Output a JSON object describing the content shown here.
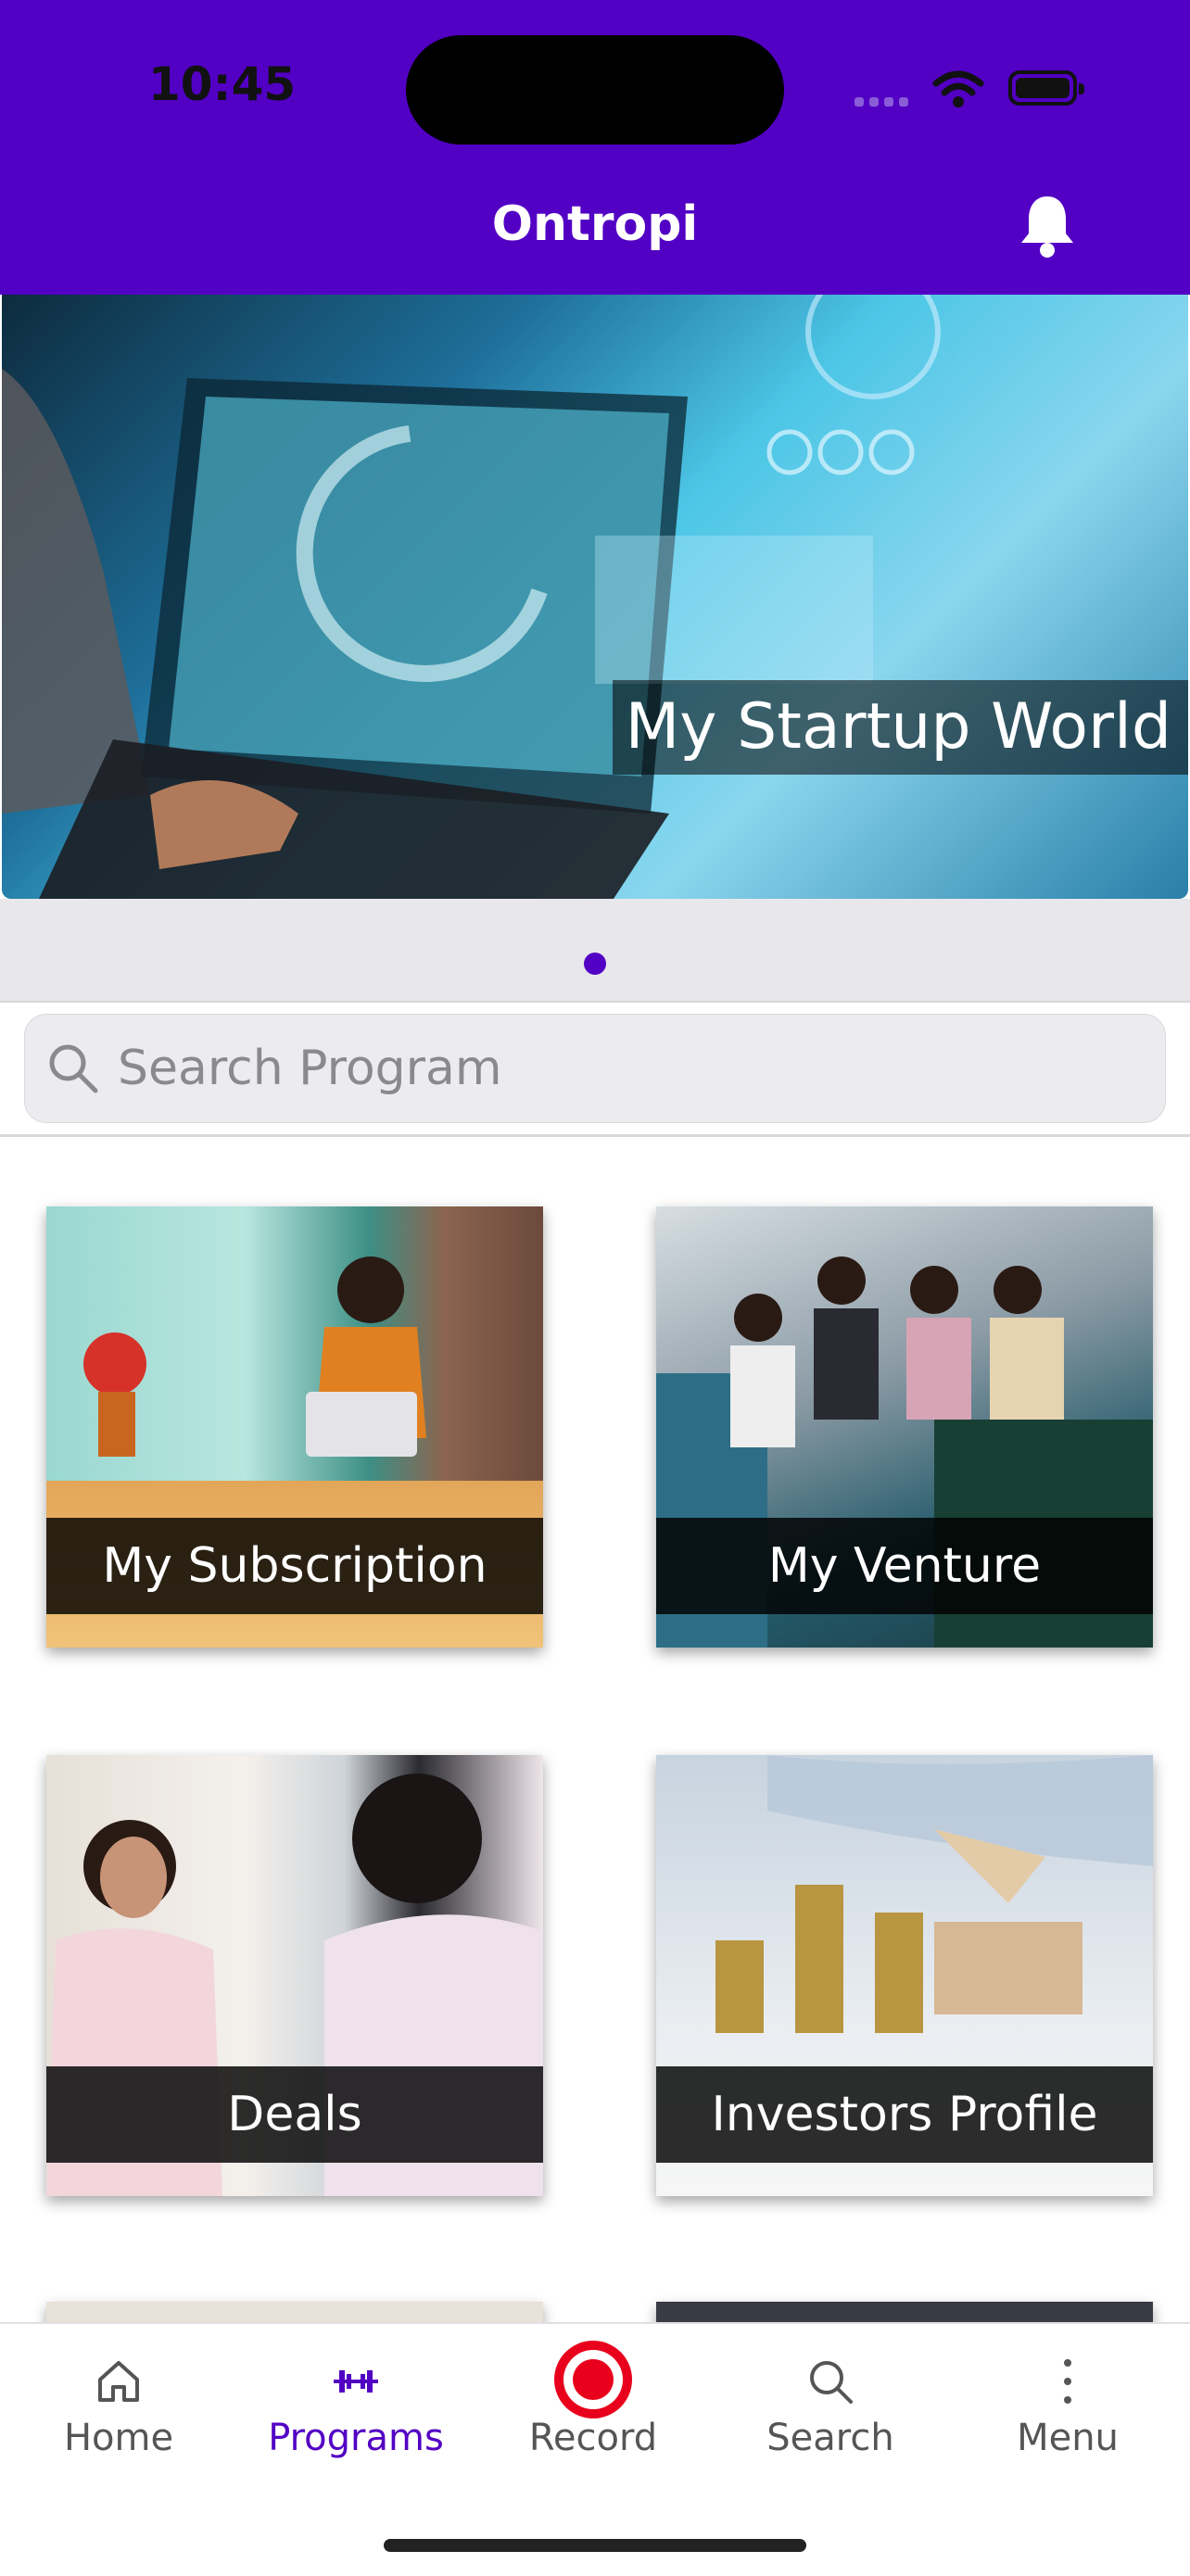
{
  "status_bar": {
    "time": "10:45"
  },
  "header": {
    "title": "Ontropi",
    "bell_icon": "bell-icon"
  },
  "banner": {
    "caption": "My Startup World",
    "page_count": 1,
    "active_page": 1
  },
  "search": {
    "placeholder": "Search Program",
    "icon": "search-icon"
  },
  "programs": [
    {
      "label": "My Subscription"
    },
    {
      "label": "My Venture"
    },
    {
      "label": "Deals"
    },
    {
      "label": "Investors Profile"
    }
  ],
  "tab_bar": {
    "items": [
      {
        "label": "Home",
        "icon": "home-icon"
      },
      {
        "label": "Programs",
        "icon": "dumbbell-icon"
      },
      {
        "label": "Record",
        "icon": "record-icon"
      },
      {
        "label": "Search",
        "icon": "search-icon"
      },
      {
        "label": "Menu",
        "icon": "more-vertical-icon"
      }
    ],
    "active": "Programs"
  },
  "colors": {
    "brand": "#5200c4",
    "record": "#e8001c"
  }
}
